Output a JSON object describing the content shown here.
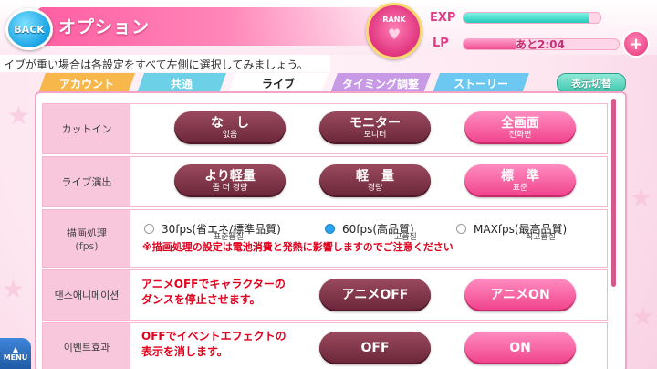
{
  "header": {
    "back_label": "BACK",
    "title": "オプション",
    "rank_label": "RANK",
    "exp_label": "EXP",
    "exp_fraction": 0.92,
    "lp_label": "LP",
    "lp_fraction": 0.34,
    "lp_value": "あと2:04",
    "plus_label": "+"
  },
  "info_text": "イブが重い場合は各設定をすべて左側に選択してみましょう。",
  "tabs": [
    {
      "label": "アカウント"
    },
    {
      "label": "共通"
    },
    {
      "label": "ライブ"
    },
    {
      "label": "タイミング調整"
    },
    {
      "label": "ストーリー"
    }
  ],
  "display_toggle": "表示切替",
  "rows": {
    "cutin": {
      "label": "カットイン",
      "options": [
        {
          "main": "な　し",
          "sub": "없음"
        },
        {
          "main": "モニター",
          "sub": "모니터"
        },
        {
          "main": "全画面",
          "sub": "전화면"
        }
      ]
    },
    "live_effect": {
      "label": "ライブ演出",
      "options": [
        {
          "main": "より軽量",
          "sub": "좀 더 경량"
        },
        {
          "main": "軽　量",
          "sub": "경량"
        },
        {
          "main": "標　準",
          "sub": "표준"
        }
      ]
    },
    "fps": {
      "label": "描画処理",
      "label_sub": "(fps)",
      "options": [
        {
          "main": "30fps(省エネ/標準品質)",
          "sub": "표준품질"
        },
        {
          "main": "60fps(高品質)",
          "sub": "고품질"
        },
        {
          "main": "MAXfps(最高品質)",
          "sub": "최고품질"
        }
      ],
      "note": "※描画処理の設定は電池消費と発熱に影響しますのでご注意ください"
    },
    "dance": {
      "label": "댄스애니메이션",
      "desc_line1": "アニメOFFでキャラクターの",
      "desc_line2": "ダンスを停止させます。",
      "options": [
        {
          "main": "アニメOFF"
        },
        {
          "main": "アニメON"
        }
      ]
    },
    "event_effect": {
      "label": "이벤트효과",
      "desc_line1": "OFFでイベントエフェクトの",
      "desc_line2": "表示を消します。",
      "options": [
        {
          "main": "OFF"
        },
        {
          "main": "ON"
        }
      ]
    }
  },
  "menu_label": "MENU",
  "colors": {
    "pink_accent": "#f0418b",
    "maroon_button": "#6a2538",
    "warning_red": "#e2001d"
  }
}
